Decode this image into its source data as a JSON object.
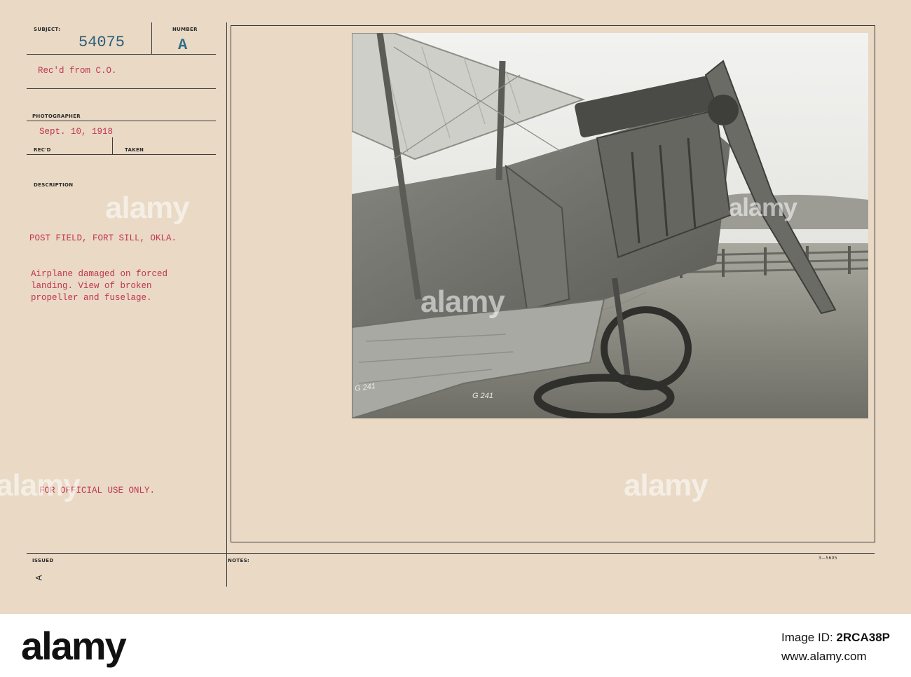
{
  "card": {
    "labels": {
      "subject": "SUBJECT:",
      "number": "NUMBER",
      "photographer": "PHOTOGRAPHER",
      "recd": "REC'D",
      "taken": "TAKEN",
      "description": "DESCRIPTION",
      "issued": "ISSUED",
      "notes": "NOTES:"
    },
    "subject_number": "54075",
    "number_letter": "A",
    "received_from": "Rec'd from C.O.",
    "date": "Sept. 10, 1918",
    "location": "POST FIELD, FORT SILL, OKLA.",
    "description_lines": [
      "Airplane damaged on forced",
      "landing. View of broken",
      "propeller and fuselage."
    ],
    "official_notice": "FOR OFFICIAL USE ONLY.",
    "issued_mark": "A",
    "form_code": "3—5605",
    "photo_markings": [
      "G 241",
      "G 241"
    ]
  },
  "watermark": "alamy",
  "footer": {
    "logo": "alamy",
    "image_id_label": "Image ID:",
    "image_id": "2RCA38P",
    "url": "www.alamy.com"
  }
}
